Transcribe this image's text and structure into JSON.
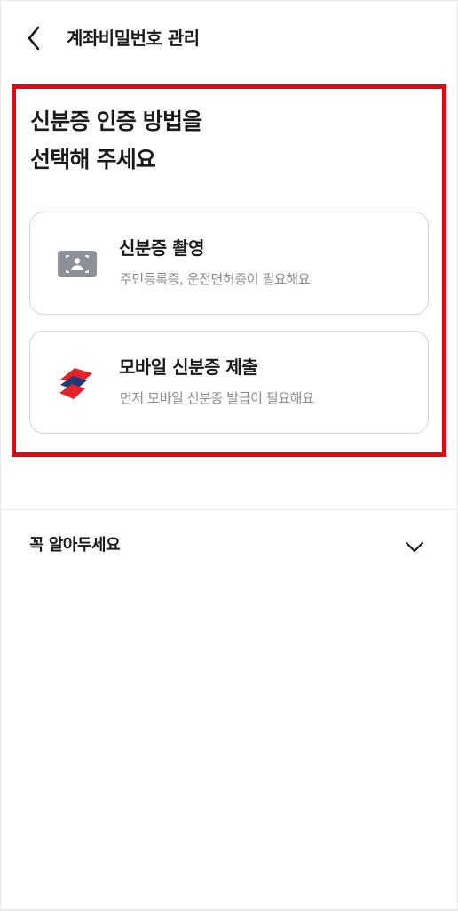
{
  "header": {
    "back_icon": "chevron-left-icon",
    "title": "계좌비밀번호 관리"
  },
  "main": {
    "title_line1": "신분증 인증 방법을",
    "title_line2": "선택해 주세요",
    "highlight_color": "#e30613"
  },
  "options": [
    {
      "icon": "id-card-scan-icon",
      "title": "신분증 촬영",
      "subtitle": "주민등록증, 운전면허증이 필요해요"
    },
    {
      "icon": "mobile-id-logo-icon",
      "title": "모바일 신분증 제출",
      "subtitle": "먼저 모바일 신분증 발급이 필요해요"
    }
  ],
  "notice": {
    "label": "꼭 알아두세요",
    "icon": "chevron-down-icon"
  },
  "colors": {
    "text_primary": "#1a1a1a",
    "text_secondary": "#8a8a8a",
    "card_border": "#d4d4d4",
    "icon_gray": "#8e9099",
    "logo_red": "#e2232a",
    "logo_navy": "#1b3a7a"
  }
}
